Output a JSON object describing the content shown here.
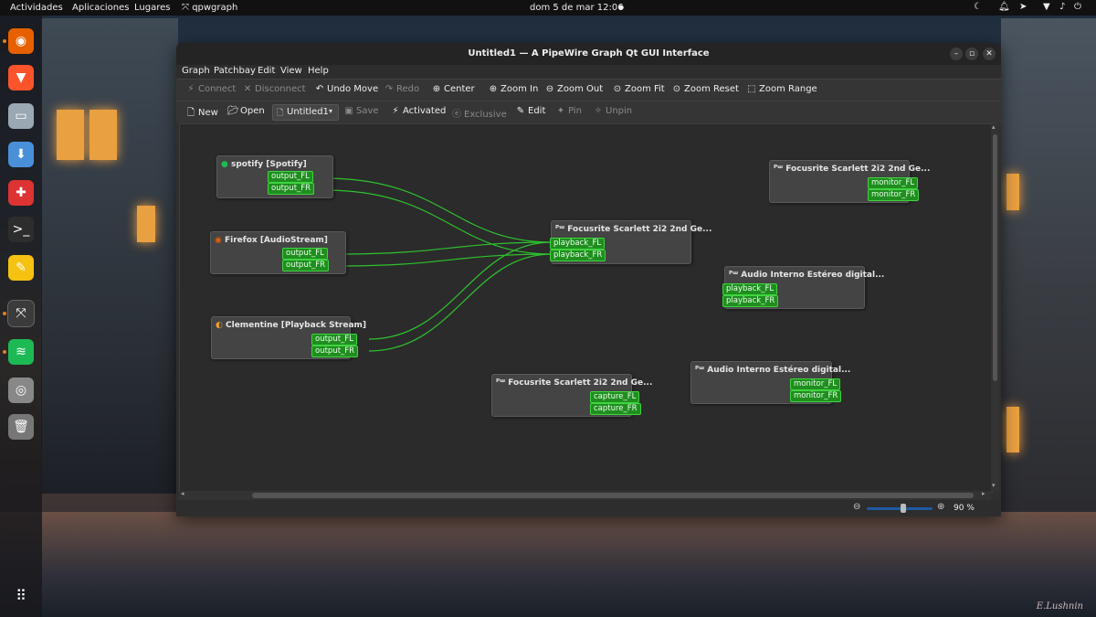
{
  "topbar": {
    "activities": "Actividades",
    "applications": "Aplicaciones",
    "places": "Lugares",
    "app_name": "qpwgraph",
    "clock": "dom  5 de mar  12:06"
  },
  "dock": {
    "apps": [
      {
        "icon": "firefox-icon",
        "color": "#e66000",
        "running": true
      },
      {
        "icon": "brave-icon",
        "color": "#fb542b",
        "running": false
      },
      {
        "icon": "files-icon",
        "color": "#9aa8b4",
        "running": false
      },
      {
        "icon": "software-icon",
        "color": "#4a90d9",
        "running": false
      },
      {
        "icon": "app-store-icon",
        "color": "#d33",
        "running": false
      },
      {
        "icon": "terminal-icon",
        "color": "#2d2d2d",
        "running": false
      },
      {
        "icon": "text-editor-icon",
        "color": "#f5c211",
        "running": false
      },
      {
        "icon": "qpwgraph-icon",
        "color": "#3b3b3b",
        "running": true
      },
      {
        "icon": "spotify-icon",
        "color": "#1db954",
        "running": true
      },
      {
        "icon": "screenshot-icon",
        "color": "#888",
        "running": false
      },
      {
        "icon": "trash-icon",
        "color": "#777",
        "running": false
      }
    ]
  },
  "window": {
    "title": "Untitled1 — A PipeWire Graph Qt GUI Interface",
    "menu": [
      "Graph",
      "Patchbay",
      "Edit",
      "View",
      "Help"
    ],
    "toolbar1": [
      {
        "label": "Connect",
        "icon": "connect-icon",
        "enabled": false
      },
      {
        "label": "Disconnect",
        "icon": "disconnect-icon",
        "enabled": false
      },
      {
        "label": "Undo Move",
        "icon": "undo-icon",
        "enabled": true
      },
      {
        "label": "Redo",
        "icon": "redo-icon",
        "enabled": false
      },
      {
        "label": "Center",
        "icon": "center-icon",
        "enabled": true
      },
      {
        "label": "Zoom In",
        "icon": "zoom-in-icon",
        "enabled": true
      },
      {
        "label": "Zoom Out",
        "icon": "zoom-out-icon",
        "enabled": true
      },
      {
        "label": "Zoom Fit",
        "icon": "zoom-fit-icon",
        "enabled": true
      },
      {
        "label": "Zoom Reset",
        "icon": "zoom-reset-icon",
        "enabled": true
      },
      {
        "label": "Zoom Range",
        "icon": "zoom-range-icon",
        "enabled": true
      }
    ],
    "toolbar2": {
      "new": "New",
      "open": "Open",
      "patchbay_name": "Untitled1",
      "save": "Save",
      "activated": "Activated",
      "exclusive": "Exclusive",
      "edit": "Edit",
      "pin": "Pin",
      "unpin": "Unpin"
    },
    "zoom": "90 %",
    "zoom_fraction": 0.55
  },
  "graph": {
    "nodes": [
      {
        "id": "spotify",
        "title": "spotify [Spotify]",
        "icon": "spotify-icon",
        "ports": [
          "output_FL",
          "output_FR"
        ]
      },
      {
        "id": "firefox",
        "title": "Firefox [AudioStream]",
        "icon": "firefox-icon",
        "ports": [
          "output_FL",
          "output_FR"
        ]
      },
      {
        "id": "clementine",
        "title": "Clementine [Playback Stream]",
        "icon": "clementine-icon",
        "ports": [
          "output_FL",
          "output_FR"
        ]
      },
      {
        "id": "focusrite_play",
        "title": "Focusrite Scarlett 2i2 2nd Ge...",
        "icon": "pipewire-icon",
        "ports": [
          "playback_FL",
          "playback_FR"
        ]
      },
      {
        "id": "focusrite_mon",
        "title": "Focusrite Scarlett 2i2 2nd Ge...",
        "icon": "pipewire-icon",
        "ports": [
          "monitor_FL",
          "monitor_FR"
        ]
      },
      {
        "id": "interno_play",
        "title": "Audio Interno Estéreo digital...",
        "icon": "pipewire-icon",
        "ports": [
          "playback_FL",
          "playback_FR"
        ]
      },
      {
        "id": "focusrite_cap",
        "title": "Focusrite Scarlett 2i2 2nd Ge...",
        "icon": "pipewire-icon",
        "ports": [
          "capture_FL",
          "capture_FR"
        ]
      },
      {
        "id": "interno_mon",
        "title": "Audio Interno Estéreo digital...",
        "icon": "pipewire-icon",
        "ports": [
          "monitor_FL",
          "monitor_FR"
        ]
      }
    ]
  }
}
